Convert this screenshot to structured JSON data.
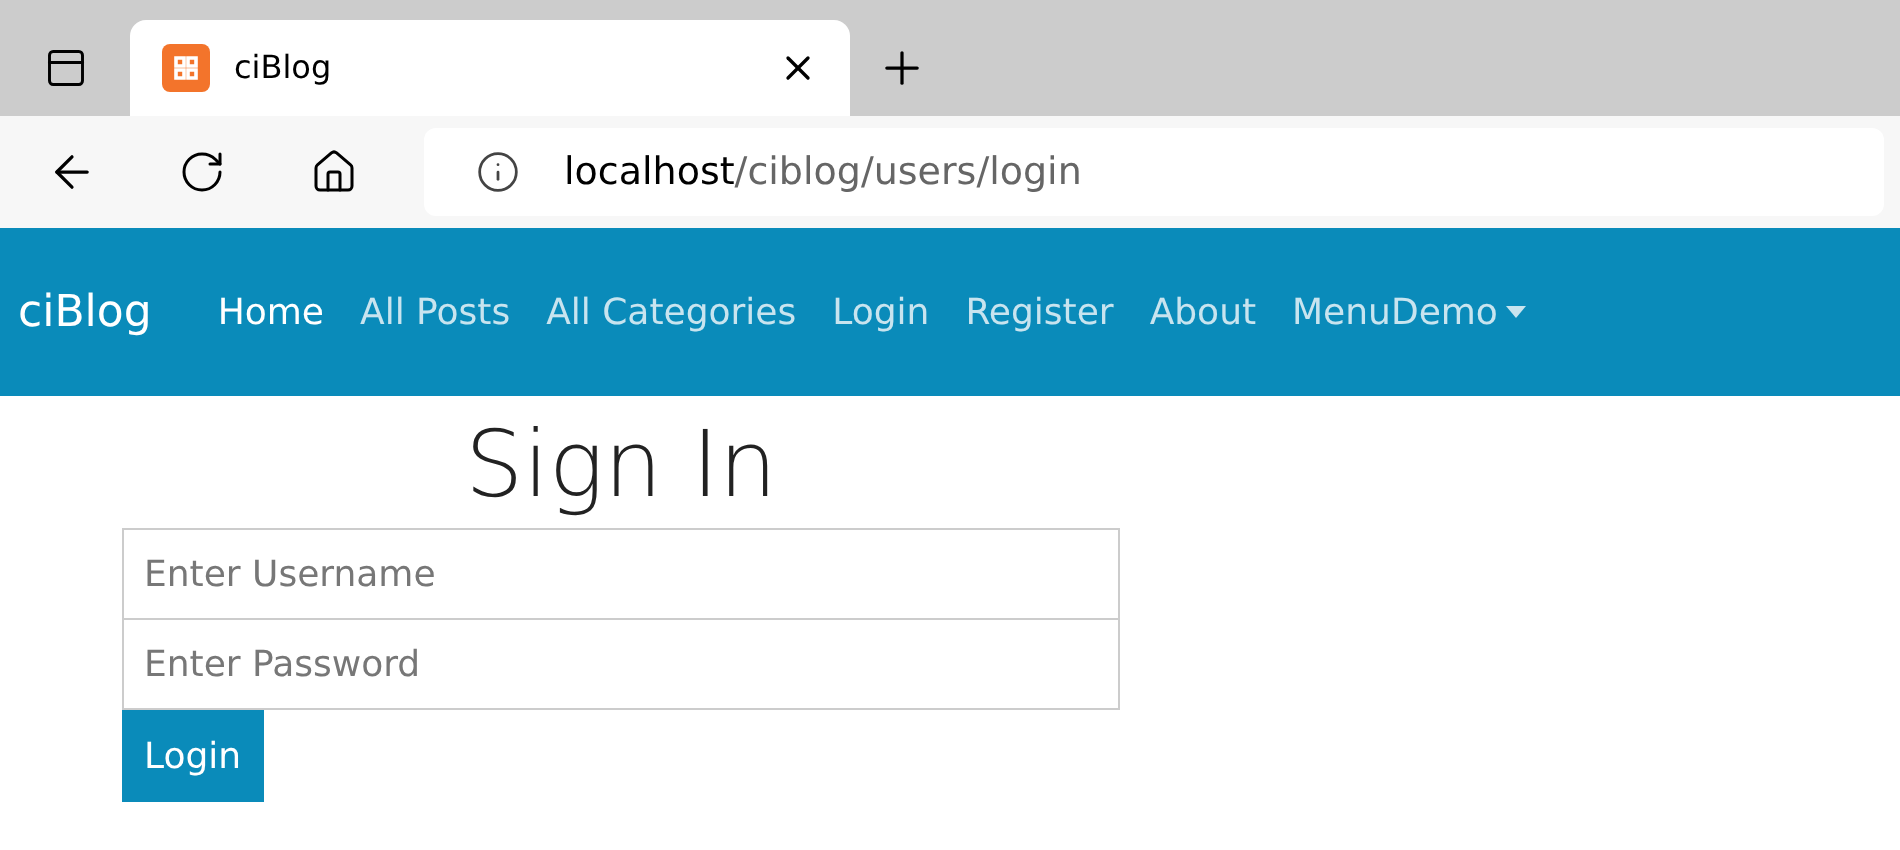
{
  "browser": {
    "tab_title": "ciBlog",
    "url_host": "localhost",
    "url_path": "/ciblog/users/login"
  },
  "navbar": {
    "brand": "ciBlog",
    "items": [
      {
        "label": "Home",
        "selected": true,
        "kind": "link"
      },
      {
        "label": "All Posts",
        "selected": false,
        "kind": "link"
      },
      {
        "label": "All Categories",
        "selected": false,
        "kind": "link"
      },
      {
        "label": "Login",
        "selected": false,
        "kind": "link"
      },
      {
        "label": "Register",
        "selected": false,
        "kind": "link"
      },
      {
        "label": "About",
        "selected": false,
        "kind": "link"
      },
      {
        "label": "MenuDemo",
        "selected": false,
        "kind": "dropdown"
      }
    ]
  },
  "form": {
    "title": "Sign In",
    "username": {
      "placeholder": "Enter Username"
    },
    "password": {
      "placeholder": "Enter Password"
    },
    "submit": "Login"
  }
}
